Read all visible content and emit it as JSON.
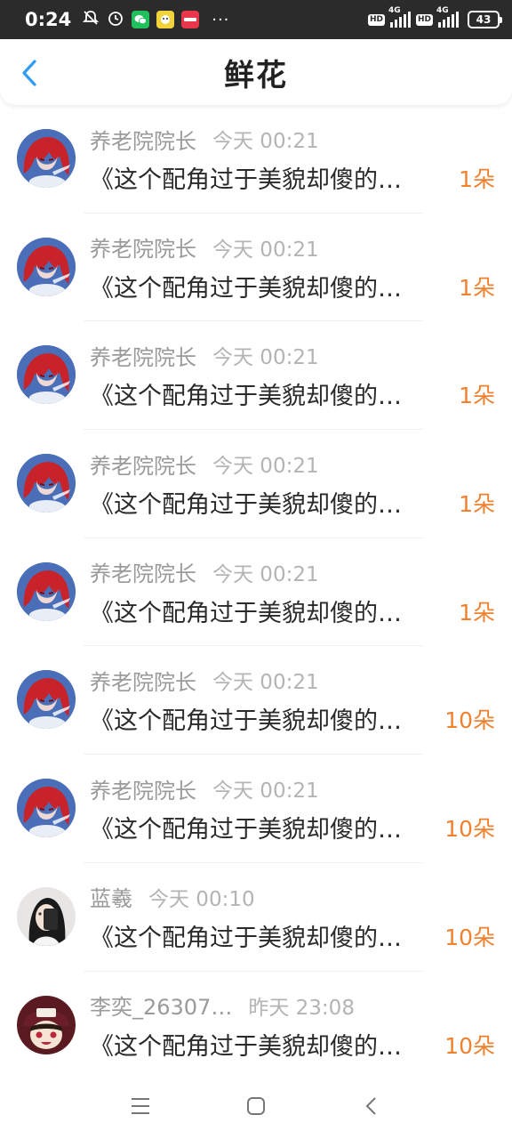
{
  "status_bar": {
    "time": "0:24",
    "dots": "···",
    "hd": "HD",
    "network": "4G",
    "battery": "43",
    "app_icons": [
      "mute-icon",
      "alarm-icon",
      "wechat-icon",
      "app-icon",
      "news-icon"
    ]
  },
  "header": {
    "title": "鲜花",
    "back_icon": "chevron-left-icon",
    "accent_color": "#2f9bf5"
  },
  "gift_list": [
    {
      "name": "养老院院长",
      "time": "今天 00:21",
      "content": "《这个配角过于美貌却傻的…",
      "count": "1朵",
      "avatar": "red-hair"
    },
    {
      "name": "养老院院长",
      "time": "今天 00:21",
      "content": "《这个配角过于美貌却傻的…",
      "count": "1朵",
      "avatar": "red-hair"
    },
    {
      "name": "养老院院长",
      "time": "今天 00:21",
      "content": "《这个配角过于美貌却傻的…",
      "count": "1朵",
      "avatar": "red-hair"
    },
    {
      "name": "养老院院长",
      "time": "今天 00:21",
      "content": "《这个配角过于美貌却傻的…",
      "count": "1朵",
      "avatar": "red-hair"
    },
    {
      "name": "养老院院长",
      "time": "今天 00:21",
      "content": "《这个配角过于美貌却傻的…",
      "count": "1朵",
      "avatar": "red-hair"
    },
    {
      "name": "养老院院长",
      "time": "今天 00:21",
      "content": "《这个配角过于美貌却傻的…",
      "count": "10朵",
      "avatar": "red-hair"
    },
    {
      "name": "养老院院长",
      "time": "今天 00:21",
      "content": "《这个配角过于美貌却傻的…",
      "count": "10朵",
      "avatar": "red-hair"
    },
    {
      "name": "蓝羲",
      "time": "今天 00:10",
      "content": "《这个配角过于美貌却傻的…",
      "count": "10朵",
      "avatar": "dark-hair"
    },
    {
      "name": "李奕_26307…",
      "time": "昨天 23:08",
      "content": "《这个配角过于美貌却傻的…",
      "count": "10朵",
      "avatar": "maroon-hat"
    }
  ],
  "count_color": "#f0812f",
  "nav_bar": {
    "icons": [
      "menu-icon",
      "home-square-icon",
      "back-triangle-icon"
    ]
  }
}
